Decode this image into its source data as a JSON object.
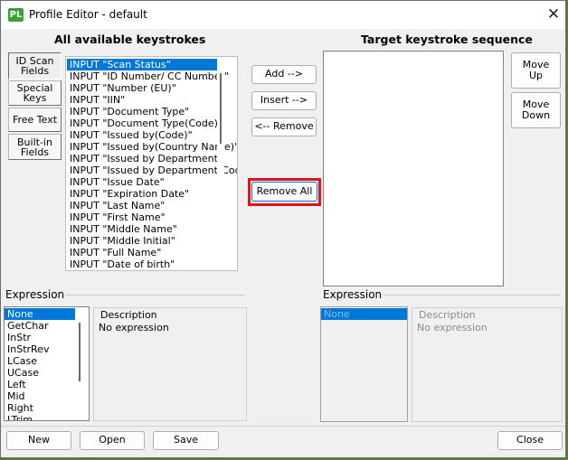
{
  "window": {
    "icon_text": "PL",
    "title": "Profile Editor - default",
    "close_glyph": "✕"
  },
  "left_panel": {
    "header": "All available keystrokes",
    "tabs": [
      {
        "label_line1": "ID Scan",
        "label_line2": "Fields"
      },
      {
        "label_line1": "Special",
        "label_line2": "Keys"
      },
      {
        "label_line1": "Free Text",
        "label_line2": ""
      },
      {
        "label_line1": "Built-in",
        "label_line2": "Fields"
      }
    ],
    "keystrokes": [
      "INPUT \"Scan Status\"",
      "INPUT \"ID Number/ CC Number\"",
      "INPUT \"Number (EU)\"",
      "INPUT \"IIN\"",
      "INPUT \"Document Type\"",
      "INPUT \"Document Type(Code)\"",
      "INPUT \"Issued by(Code)\"",
      "INPUT \"Issued by(Country Name)\"",
      "INPUT \"Issued by Department\"",
      "INPUT \"Issued by Department(Code\"",
      "INPUT \"Issue Date\"",
      "INPUT \"Expiration Date\"",
      "INPUT \"Last Name\"",
      "INPUT \"First Name\"",
      "INPUT \"Middle Name\"",
      "INPUT \"Middle Initial\"",
      "INPUT \"Full Name\"",
      "INPUT \"Date of birth\""
    ]
  },
  "middle_buttons": {
    "add": "Add -->",
    "insert": "Insert -->",
    "remove": "<-- Remove",
    "remove_all": "Remove All"
  },
  "right_panel": {
    "header": "Target keystroke sequence",
    "move_up_1": "Move",
    "move_up_2": "Up",
    "move_down_1": "Move",
    "move_down_2": "Down"
  },
  "expression_left": {
    "title": "Expression",
    "items": [
      "None",
      "GetChar",
      "InStr",
      "InStrRev",
      "LCase",
      "UCase",
      "Left",
      "Mid",
      "Right",
      "LTrim"
    ],
    "description_label": "Description",
    "description_text": "No expression"
  },
  "expression_right": {
    "title": "Expression",
    "items": [
      "None"
    ],
    "description_label": "Description",
    "description_text": "No expression"
  },
  "bottom_buttons": {
    "new": "New",
    "open": "Open",
    "save": "Save",
    "close": "Close"
  },
  "colors": {
    "selection": "#0078d7",
    "highlight_border": "#e0141e",
    "app_icon": "#3aa133"
  }
}
